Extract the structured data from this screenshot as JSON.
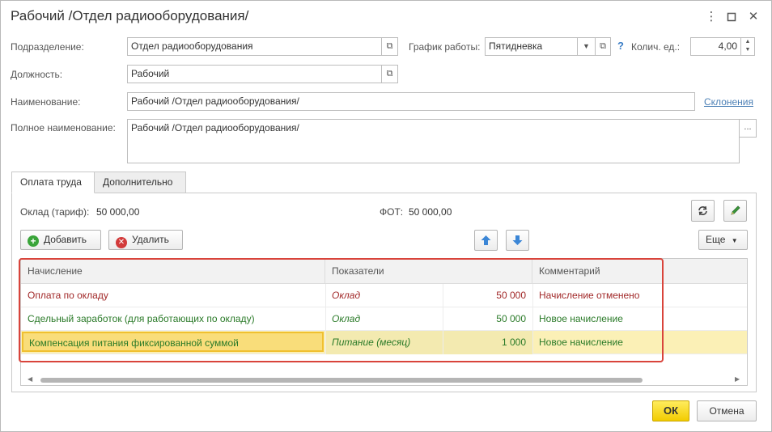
{
  "window": {
    "title": "Рабочий /Отдел радиооборудования/",
    "more_icon": "more-vertical-icon",
    "maximize_icon": "maximize-icon",
    "close_icon": "close-icon"
  },
  "form": {
    "department_label": "Подразделение:",
    "department_value": "Отдел радиооборудования",
    "schedule_label": "График работы:",
    "schedule_value": "Пятидневка",
    "units_label": "Колич. ед.:",
    "units_value": "4,00",
    "position_label": "Должность:",
    "position_value": "Рабочий",
    "name_label": "Наименование:",
    "name_value": "Рабочий /Отдел радиооборудования/",
    "declension_link": "Склонения",
    "full_name_label": "Полное наименование:",
    "full_name_value": "Рабочий /Отдел радиооборудования/",
    "help_mark": "?",
    "ellipsis": "..."
  },
  "tabs": [
    {
      "label": "Оплата труда",
      "active": true
    },
    {
      "label": "Дополнительно",
      "active": false
    }
  ],
  "pay": {
    "salary_label": "Оклад (тариф):",
    "salary_value": "50 000,00",
    "fot_label": "ФОТ:",
    "fot_value": "50 000,00"
  },
  "toolbar": {
    "add_label": "Добавить",
    "delete_label": "Удалить",
    "more_label": "Еще"
  },
  "table": {
    "columns": [
      "Начисление",
      "Показатели",
      "Комментарий"
    ],
    "rows": [
      {
        "accrual": "Оплата по окладу",
        "indicator": "Оклад",
        "value": "50 000",
        "comment": "Начисление отменено",
        "color": "#a12828",
        "selected": false
      },
      {
        "accrual": "Сдельный заработок (для работающих по окладу)",
        "indicator": "Оклад",
        "value": "50 000",
        "comment": "Новое начисление",
        "color": "#2a7a28",
        "selected": false
      },
      {
        "accrual": "Компенсация питания фиксированной суммой",
        "indicator": "Питание (месяц)",
        "value": "1 000",
        "comment": "Новое начисление",
        "color": "#2a7a28",
        "selected": true
      }
    ]
  },
  "footer": {
    "ok_label": "ОК",
    "cancel_label": "Отмена"
  },
  "colors": {
    "accent_yellow": "#f2cc00",
    "selection": "#fbf0b6",
    "highlight_border": "#d9443b",
    "link": "#4b7fb5"
  }
}
